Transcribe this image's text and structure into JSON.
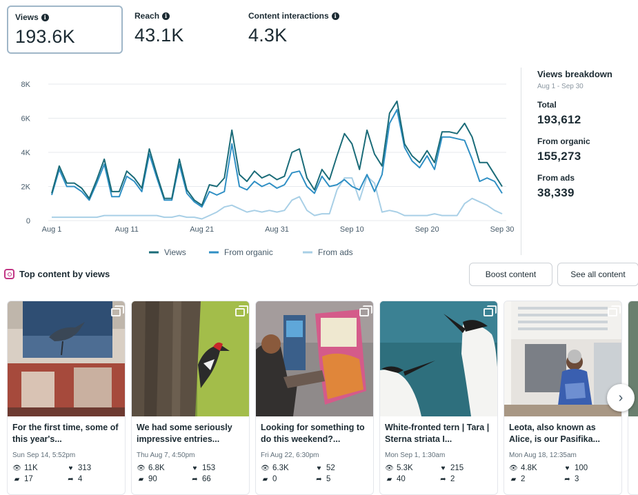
{
  "metrics": [
    {
      "label": "Views",
      "value": "193.6K",
      "active": true
    },
    {
      "label": "Reach",
      "value": "43.1K",
      "active": false
    },
    {
      "label": "Content interactions",
      "value": "4.3K",
      "active": false
    }
  ],
  "chart_data": {
    "type": "line",
    "x_ticks": [
      "Aug 1",
      "Aug 11",
      "Aug 21",
      "Aug 31",
      "Sep 10",
      "Sep 20",
      "Sep 30"
    ],
    "y_ticks": [
      "0",
      "2K",
      "4K",
      "6K",
      "8K"
    ],
    "ylim": [
      0,
      8000
    ],
    "x": [
      "Aug 1",
      "Aug 2",
      "Aug 3",
      "Aug 4",
      "Aug 5",
      "Aug 6",
      "Aug 7",
      "Aug 8",
      "Aug 9",
      "Aug 10",
      "Aug 11",
      "Aug 12",
      "Aug 13",
      "Aug 14",
      "Aug 15",
      "Aug 16",
      "Aug 17",
      "Aug 18",
      "Aug 19",
      "Aug 20",
      "Aug 21",
      "Aug 22",
      "Aug 23",
      "Aug 24",
      "Aug 25",
      "Aug 26",
      "Aug 27",
      "Aug 28",
      "Aug 29",
      "Aug 30",
      "Aug 31",
      "Sep 1",
      "Sep 2",
      "Sep 3",
      "Sep 4",
      "Sep 5",
      "Sep 6",
      "Sep 7",
      "Sep 8",
      "Sep 9",
      "Sep 10",
      "Sep 11",
      "Sep 12",
      "Sep 13",
      "Sep 14",
      "Sep 15",
      "Sep 16",
      "Sep 17",
      "Sep 18",
      "Sep 19",
      "Sep 20",
      "Sep 21",
      "Sep 22",
      "Sep 23",
      "Sep 24",
      "Sep 25",
      "Sep 26",
      "Sep 27",
      "Sep 28",
      "Sep 29",
      "Sep 30"
    ],
    "series": [
      {
        "name": "Views",
        "color": "#1a6b78",
        "values": [
          1600,
          3200,
          2200,
          2200,
          1900,
          1300,
          2400,
          3600,
          1700,
          1700,
          2900,
          2500,
          1900,
          4200,
          2700,
          1300,
          1300,
          3600,
          1800,
          1200,
          900,
          2100,
          2000,
          2500,
          5300,
          2700,
          2300,
          2900,
          2500,
          2700,
          2400,
          2600,
          4000,
          4200,
          2500,
          1800,
          3000,
          2400,
          3800,
          5100,
          4500,
          3000,
          5300,
          3900,
          3200,
          6300,
          7000,
          4500,
          3800,
          3400,
          4100,
          3400,
          5200,
          5200,
          5100,
          5700,
          4900,
          3400,
          3400,
          2700,
          2000
        ]
      },
      {
        "name": "From organic",
        "color": "#2f8fc4",
        "values": [
          1500,
          3000,
          2000,
          2000,
          1700,
          1200,
          2200,
          3300,
          1400,
          1400,
          2600,
          2300,
          1700,
          3900,
          2500,
          1200,
          1200,
          3300,
          1600,
          1100,
          800,
          1700,
          1500,
          1700,
          4500,
          2000,
          1800,
          2300,
          2000,
          2200,
          1900,
          2100,
          2800,
          2900,
          2000,
          1600,
          2600,
          2000,
          2100,
          2400,
          2000,
          1800,
          2700,
          1700,
          2700,
          5700,
          6500,
          4300,
          3500,
          3100,
          3800,
          3000,
          4900,
          4900,
          4800,
          4700,
          3600,
          2300,
          2500,
          2300,
          1600
        ]
      },
      {
        "name": "From ads",
        "color": "#a8cfe6",
        "values": [
          200,
          200,
          200,
          200,
          200,
          200,
          200,
          300,
          300,
          300,
          300,
          300,
          300,
          300,
          300,
          200,
          200,
          300,
          200,
          200,
          100,
          300,
          500,
          800,
          900,
          700,
          500,
          600,
          500,
          600,
          500,
          600,
          1200,
          1400,
          600,
          300,
          400,
          400,
          1800,
          2500,
          2500,
          1200,
          2600,
          2200,
          500,
          600,
          500,
          300,
          300,
          300,
          300,
          400,
          300,
          300,
          300,
          1000,
          1300,
          1100,
          900,
          600,
          400
        ]
      }
    ]
  },
  "breakdown": {
    "title": "Views breakdown",
    "range": "Aug 1 - Sep 30",
    "total_label": "Total",
    "total": "193,612",
    "organic_label": "From organic",
    "organic": "155,273",
    "ads_label": "From ads",
    "ads": "38,339"
  },
  "top_content": {
    "title": "Top content by views",
    "boost_label": "Boost content",
    "see_all_label": "See all content"
  },
  "cards": [
    {
      "text": "For the first time, some of this year's...",
      "date": "Sun Sep 14, 5:52pm",
      "views": "11K",
      "likes": "313",
      "comments": "17",
      "shares": "4"
    },
    {
      "text": "We had some seriously impressive entries...",
      "date": "Thu Aug 7, 4:50pm",
      "views": "6.8K",
      "likes": "153",
      "comments": "90",
      "shares": "66"
    },
    {
      "text": "Looking for something to do this weekend?...",
      "date": "Fri Aug 22, 6:30pm",
      "views": "6.3K",
      "likes": "52",
      "comments": "0",
      "shares": "5"
    },
    {
      "text": "White-fronted tern | Tara | Sterna striata I...",
      "date": "Mon Sep 1, 1:30am",
      "views": "5.3K",
      "likes": "215",
      "comments": "40",
      "shares": "2"
    },
    {
      "text": "Leota, also known as Alice, is our Pasifika...",
      "date": "Mon Aug 18, 12:35am",
      "views": "4.8K",
      "likes": "100",
      "comments": "2",
      "shares": "3"
    }
  ],
  "icons": {
    "info": "info-icon",
    "instagram": "instagram-icon",
    "views": "eye-icon",
    "likes": "heart-icon",
    "comments": "comment-icon",
    "shares": "share-icon",
    "next": "chevron-right-icon"
  }
}
